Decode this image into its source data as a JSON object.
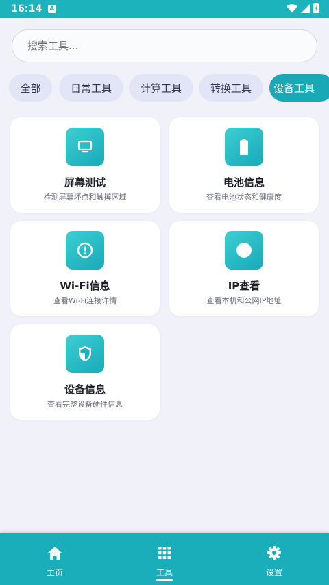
{
  "status_bar": {
    "time": "16:14",
    "notification_icon": "a-notification-icon",
    "icons": [
      "wifi-icon",
      "signal-icon",
      "battery-charging-icon"
    ]
  },
  "search": {
    "placeholder": "搜索工具..."
  },
  "categories": [
    {
      "label": "全部",
      "active": false
    },
    {
      "label": "日常工具",
      "active": false
    },
    {
      "label": "计算工具",
      "active": false
    },
    {
      "label": "转换工具",
      "active": false
    },
    {
      "label": "设备工具",
      "active": true
    }
  ],
  "tools": [
    {
      "title": "屏幕测试",
      "desc": "检测屏幕坏点和触摸区域",
      "icon": "monitor-icon"
    },
    {
      "title": "电池信息",
      "desc": "查看电池状态和健康度",
      "icon": "battery-icon"
    },
    {
      "title": "Wi-Fi信息",
      "desc": "查看Wi-Fi连接详情",
      "icon": "info-circle-icon"
    },
    {
      "title": "IP查看",
      "desc": "查看本机和公网IP地址",
      "icon": "circle-icon"
    },
    {
      "title": "设备信息",
      "desc": "查看完整设备硬件信息",
      "icon": "shield-icon"
    }
  ],
  "bottom_nav": [
    {
      "label": "主页",
      "icon": "home-icon",
      "active": false
    },
    {
      "label": "工具",
      "icon": "grid-icon",
      "active": true
    },
    {
      "label": "设置",
      "icon": "gear-icon",
      "active": false
    }
  ],
  "colors": {
    "accent": "#19aeb9",
    "background": "#f1f1f9",
    "chip_bg": "#e1e5f6"
  }
}
